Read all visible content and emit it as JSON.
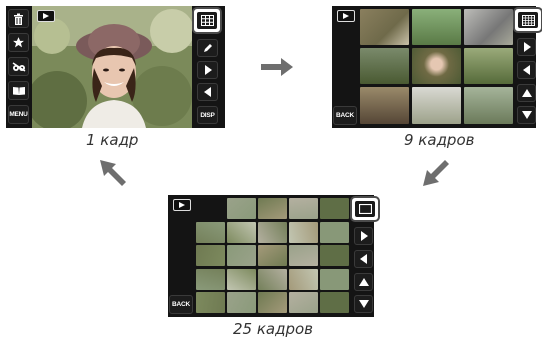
{
  "captions": {
    "single": "1 кадр",
    "nine": "9 кадров",
    "twentyfive": "25 кадров"
  },
  "buttons": {
    "menu": "MENU",
    "disp": "DISP",
    "back": "BACK"
  },
  "icons": [
    "trash-icon",
    "favorite-star-icon",
    "red-eye-icon",
    "photobook-icon",
    "grid-view-icon",
    "edit-pen-icon",
    "next-arrow-icon",
    "prev-arrow-icon",
    "up-arrow-icon",
    "down-arrow-icon",
    "single-frame-icon",
    "playback-icon"
  ],
  "colors": {
    "screen_bg": "#141414",
    "button_bg": "#1c1c1c",
    "arrow_gray": "#6e6e6e",
    "caption_text": "#333333"
  }
}
